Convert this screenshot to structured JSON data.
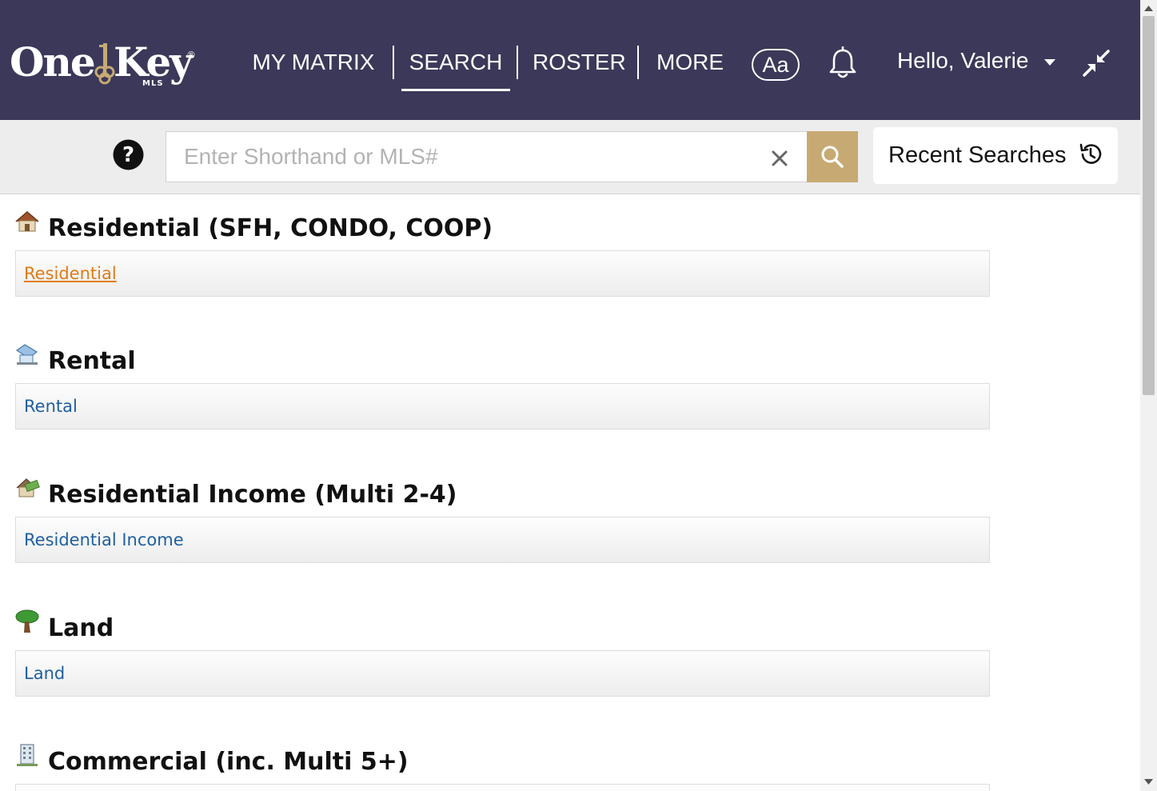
{
  "header": {
    "logo": {
      "word1": "One",
      "word2": "Key",
      "registered": "®",
      "sub": "MLS"
    },
    "nav": [
      {
        "label": "MY MATRIX"
      },
      {
        "label": "SEARCH",
        "active": true
      },
      {
        "label": "ROSTER"
      },
      {
        "label": "MORE"
      }
    ],
    "font_button_label": "Aa",
    "greeting": "Hello, Valerie",
    "colors": {
      "background": "#3b3859",
      "text": "#ffffff"
    }
  },
  "search": {
    "placeholder": "Enter Shorthand or MLS#",
    "value": "",
    "recent_label": "Recent Searches",
    "button_color": "#c7aa73"
  },
  "sections": [
    {
      "icon": "house-icon",
      "title": "Residential (SFH, CONDO, COOP)",
      "link": "Residential",
      "active": true
    },
    {
      "icon": "rental-icon",
      "title": "Rental",
      "link": "Rental"
    },
    {
      "icon": "money-house-icon",
      "title": "Residential Income (Multi 2-4)",
      "link": "Residential Income"
    },
    {
      "icon": "tree-icon",
      "title": "Land",
      "link": "Land"
    },
    {
      "icon": "building-icon",
      "title": "Commercial (inc. Multi 5+)",
      "link": ""
    }
  ],
  "colors": {
    "link": "#1f5fa0",
    "link_active": "#e07b16"
  }
}
